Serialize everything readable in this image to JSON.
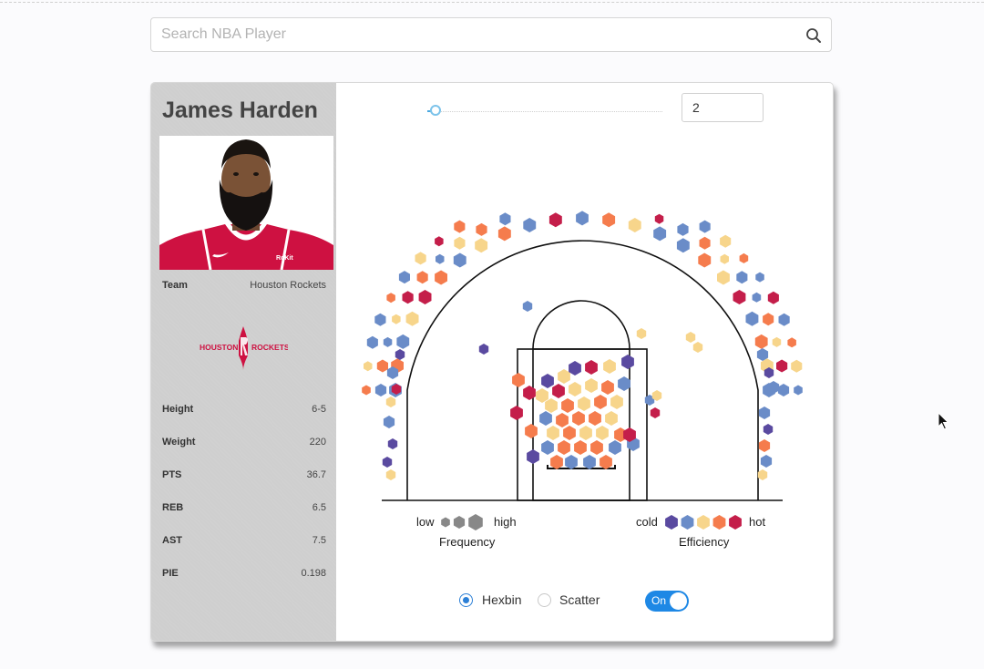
{
  "search": {
    "placeholder": "Search NBA Player",
    "icon": "search-icon"
  },
  "player": {
    "name": "James Harden",
    "team_label": "Team",
    "team": "Houston Rockets",
    "jersey_text": "RoKit",
    "logo_text_left": "HOUSTON",
    "logo_text_right": "ROCKETS",
    "stats": [
      {
        "label": "Height",
        "value": "6-5"
      },
      {
        "label": "Weight",
        "value": "220"
      },
      {
        "label": "PTS",
        "value": "36.7"
      },
      {
        "label": "REB",
        "value": "6.5"
      },
      {
        "label": "AST",
        "value": "7.5"
      },
      {
        "label": "PIE",
        "value": "0.198"
      }
    ]
  },
  "controls": {
    "slider_value": 2,
    "number_input": "2",
    "chart_mode_options": [
      "Hexbin",
      "Scatter"
    ],
    "chart_mode_selected": "Hexbin",
    "toggle_label": "On",
    "toggle_state": true
  },
  "legend": {
    "frequency": {
      "low": "low",
      "high": "high",
      "title": "Frequency"
    },
    "efficiency": {
      "cold": "cold",
      "hot": "hot",
      "title": "Efficiency"
    },
    "efficiency_colors": [
      "#5a4aa0",
      "#6a8cc8",
      "#f7d58b",
      "#f57c4d",
      "#c41e4a"
    ],
    "frequency_color": "#888888"
  },
  "colors": {
    "accent": "#1e88e5",
    "team_red": "#ce1141",
    "sidebar_bg": "#cfcfcf"
  }
}
